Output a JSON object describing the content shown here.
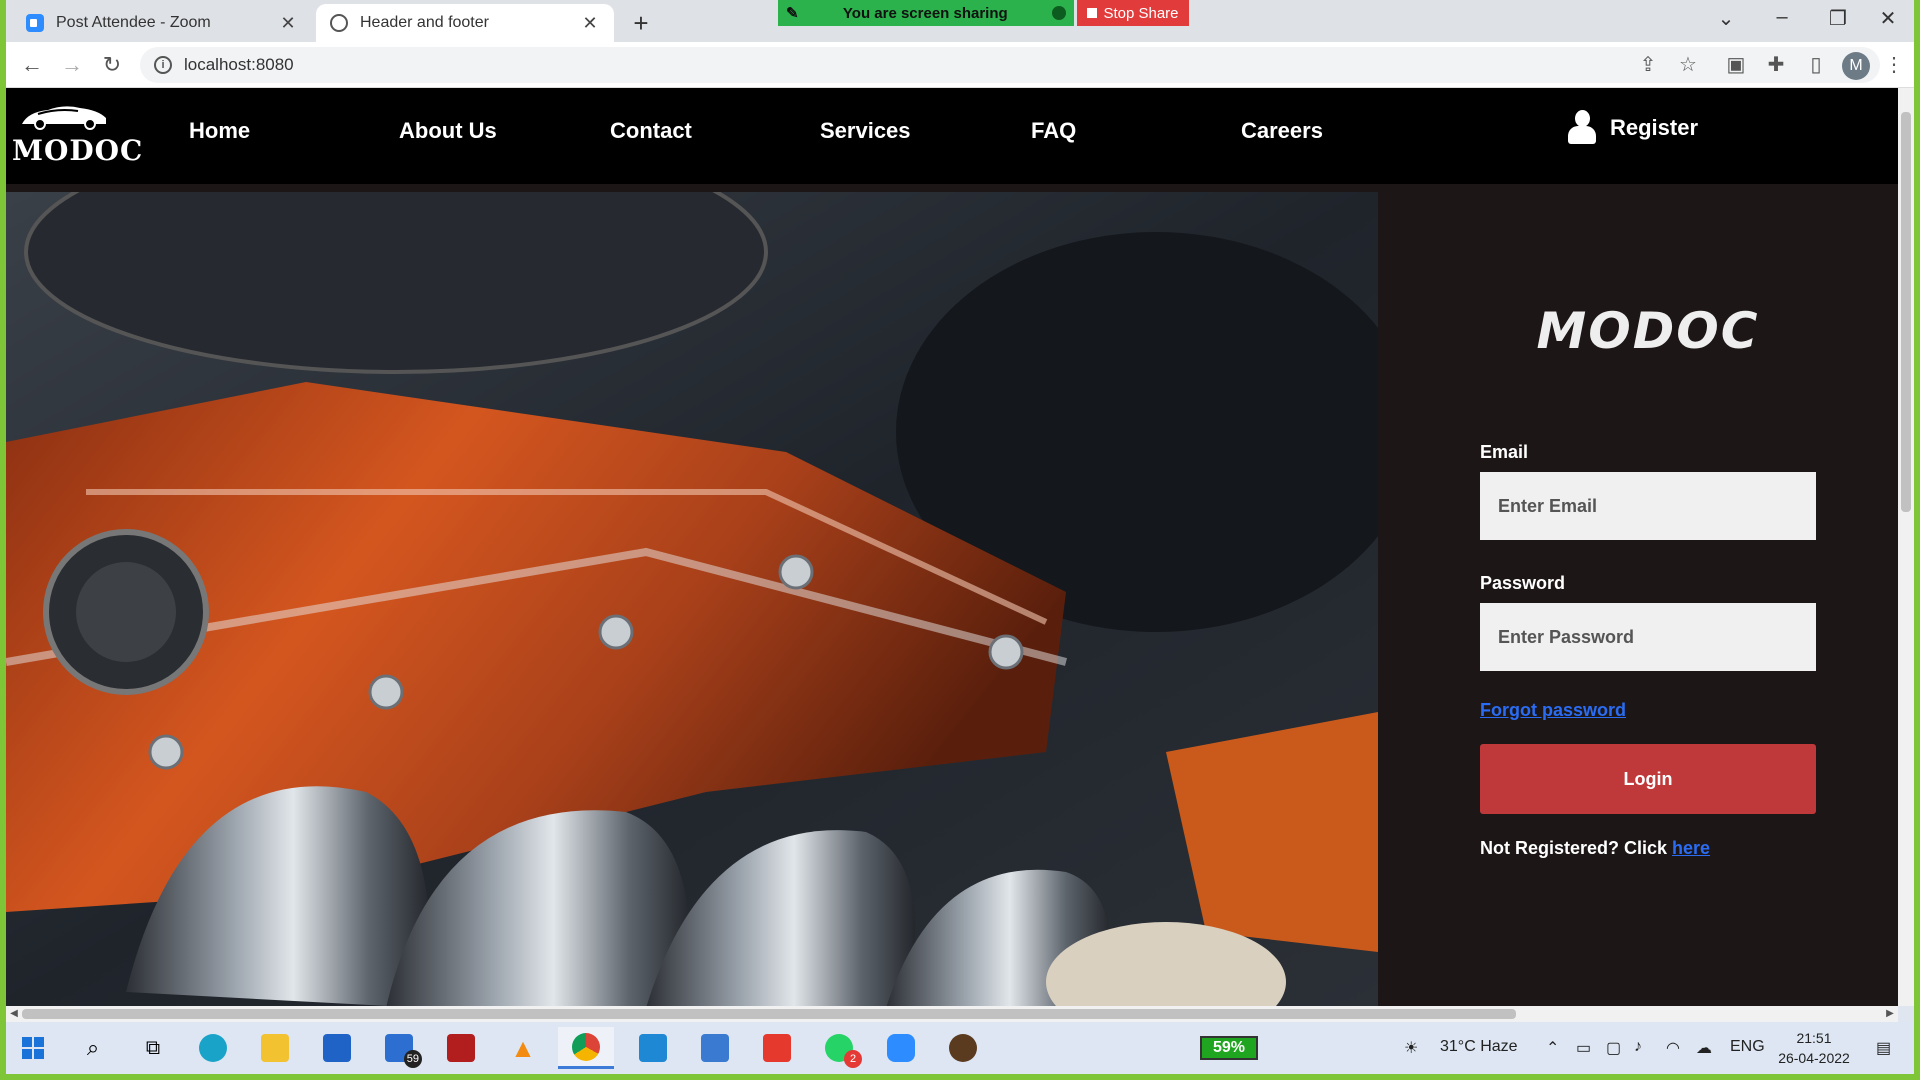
{
  "browser": {
    "tabs": [
      {
        "title": "Post Attendee - Zoom",
        "icon": "zoom-icon"
      },
      {
        "title": "Header and footer",
        "icon": "globe-icon"
      }
    ],
    "url": "localhost:8080",
    "profile_initial": "M"
  },
  "share_banner": {
    "status": "You are screen sharing",
    "stop_label": "Stop Share"
  },
  "site": {
    "logo_text": "MODOC",
    "nav": [
      "Home",
      "About Us",
      "Contact",
      "Services",
      "FAQ",
      "Careers"
    ],
    "register_label": "Register"
  },
  "login": {
    "brand": "MODOC",
    "email_label": "Email",
    "email_placeholder": "Enter Email",
    "password_label": "Password",
    "password_placeholder": "Enter Password",
    "forgot_label": "Forgot password",
    "button_label": "Login",
    "not_registered_text": "Not Registered? Click ",
    "here_label": "here"
  },
  "taskbar": {
    "battery": "59%",
    "mail_badge": "59",
    "whatsapp_badge": "2",
    "weather": "31°C  Haze",
    "language": "ENG",
    "time": "21:51",
    "date": "26-04-2022"
  },
  "colors": {
    "accent": "#c0393a",
    "link": "#2a6df4",
    "panel_bg": "#1d1616",
    "header_bg": "#000000"
  }
}
